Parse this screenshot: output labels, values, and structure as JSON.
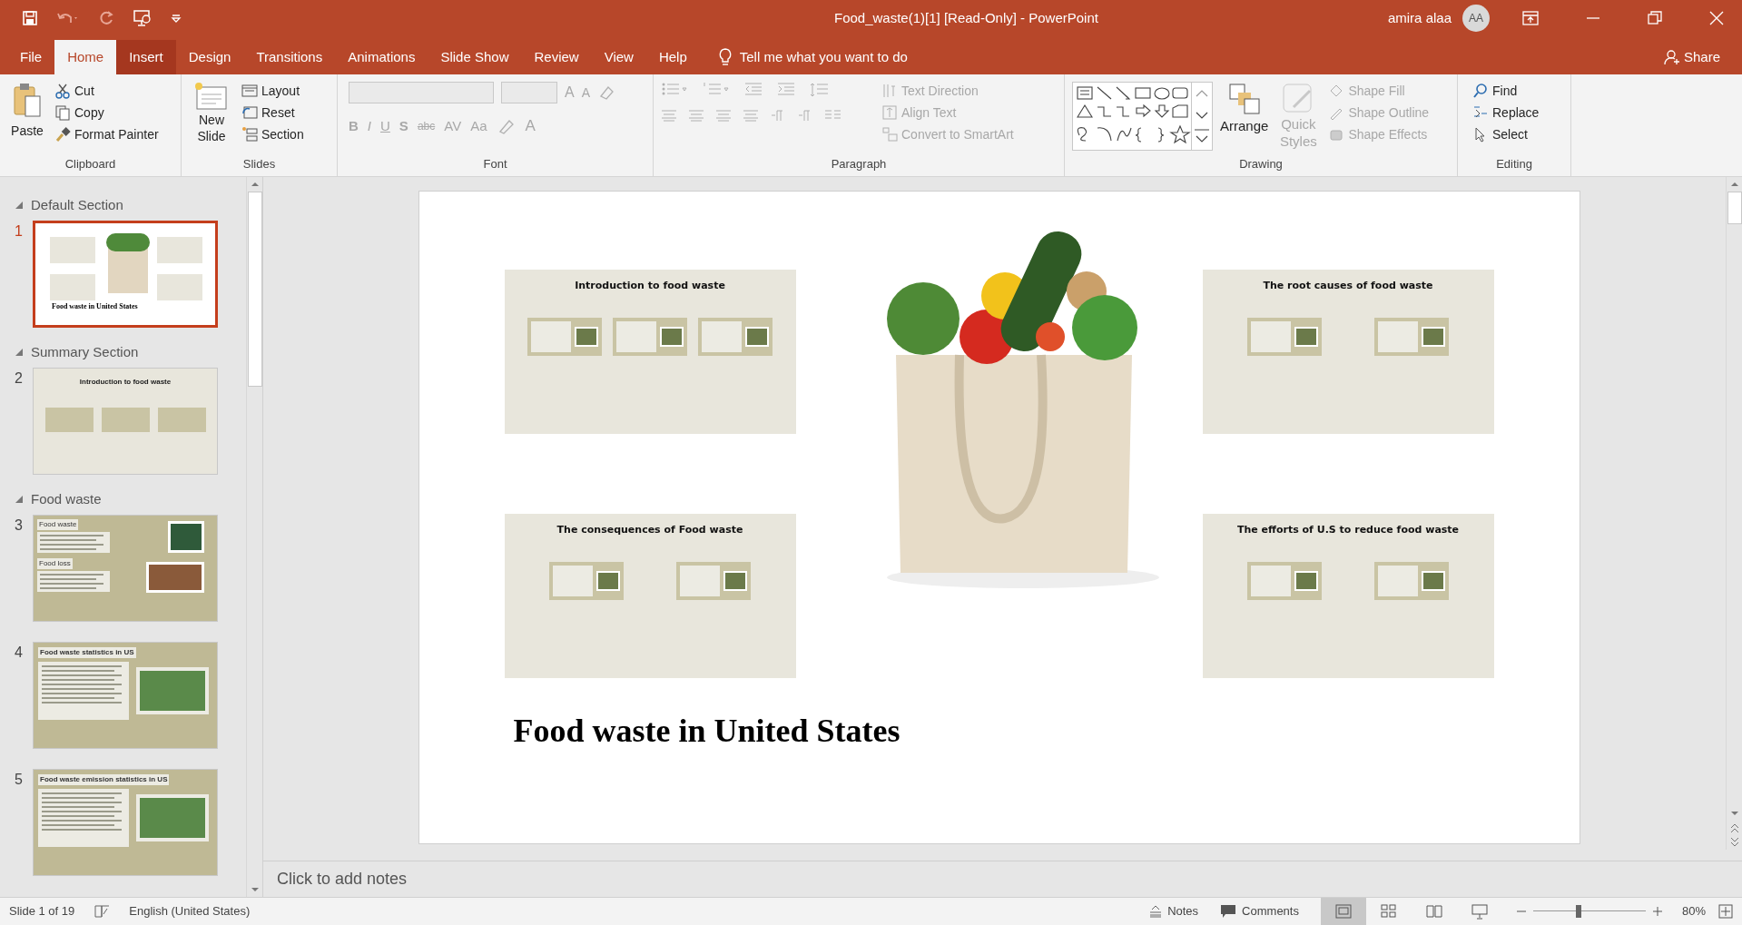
{
  "window": {
    "title": "Food_waste(1)[1] [Read-Only]  -  PowerPoint",
    "user": "amira alaa",
    "avatar": "AA"
  },
  "tabs": [
    {
      "label": "File",
      "selected": false,
      "highlighted": false
    },
    {
      "label": "Home",
      "selected": true,
      "highlighted": false
    },
    {
      "label": "Insert",
      "selected": false,
      "highlighted": true
    },
    {
      "label": "Design",
      "selected": false,
      "highlighted": false
    },
    {
      "label": "Transitions",
      "selected": false,
      "highlighted": false
    },
    {
      "label": "Animations",
      "selected": false,
      "highlighted": false
    },
    {
      "label": "Slide Show",
      "selected": false,
      "highlighted": false
    },
    {
      "label": "Review",
      "selected": false,
      "highlighted": false
    },
    {
      "label": "View",
      "selected": false,
      "highlighted": false
    },
    {
      "label": "Help",
      "selected": false,
      "highlighted": false
    }
  ],
  "tell_me": "Tell me what you want to do",
  "share": "Share",
  "ribbon": {
    "clipboard": {
      "label": "Clipboard",
      "paste": "Paste",
      "items": [
        {
          "label": "Cut",
          "disabled": false
        },
        {
          "label": "Copy",
          "disabled": false
        },
        {
          "label": "Format Painter",
          "disabled": false
        }
      ]
    },
    "slides": {
      "label": "Slides",
      "new_slide": "New Slide",
      "items": [
        {
          "label": "Layout",
          "disabled": false
        },
        {
          "label": "Reset",
          "disabled": false
        },
        {
          "label": "Section",
          "disabled": false
        }
      ]
    },
    "font": {
      "label": "Font",
      "buttons": [
        {
          "label": "B",
          "disabled": true
        },
        {
          "label": "I",
          "disabled": true
        },
        {
          "label": "U",
          "disabled": true
        },
        {
          "label": "S",
          "disabled": true
        },
        {
          "label": "abc",
          "disabled": true
        },
        {
          "label": "AV",
          "disabled": true
        },
        {
          "label": "Aa",
          "disabled": true
        }
      ],
      "color_button": {
        "label": "A",
        "disabled": true
      },
      "grow": {
        "label": "A",
        "disabled": true
      },
      "shrink": {
        "label": "A",
        "disabled": true
      }
    },
    "paragraph": {
      "label": "Paragraph",
      "items": [
        {
          "label": "Text Direction",
          "disabled": true
        },
        {
          "label": "Align Text",
          "disabled": true
        },
        {
          "label": "Convert to SmartArt",
          "disabled": true
        }
      ]
    },
    "drawing": {
      "label": "Drawing",
      "arrange": "Arrange",
      "quick_styles": {
        "label": "Quick Styles",
        "disabled": true
      },
      "items": [
        {
          "label": "Shape Fill",
          "disabled": true
        },
        {
          "label": "Shape Outline",
          "disabled": true
        },
        {
          "label": "Shape Effects",
          "disabled": true
        }
      ]
    },
    "editing": {
      "label": "Editing",
      "items": [
        {
          "label": "Find",
          "disabled": false
        },
        {
          "label": "Replace",
          "disabled": false
        },
        {
          "label": "Select",
          "disabled": false
        }
      ]
    }
  },
  "sections": [
    {
      "name": "Default Section",
      "expanded": true,
      "slides": [
        {
          "number": "1",
          "selected": true,
          "kind": "title",
          "heading": "Food waste in United States"
        }
      ]
    },
    {
      "name": "Summary Section",
      "expanded": true,
      "slides": [
        {
          "number": "2",
          "selected": false,
          "kind": "overview",
          "heading": "Introduction to food waste"
        }
      ]
    },
    {
      "name": "Food waste",
      "expanded": true,
      "slides": [
        {
          "number": "3",
          "selected": false,
          "kind": "definitions",
          "blocks": [
            {
              "heading": "Food waste"
            },
            {
              "heading": "Food loss"
            }
          ]
        },
        {
          "number": "4",
          "selected": false,
          "kind": "bullets",
          "heading": "Food waste statistics in US"
        },
        {
          "number": "5",
          "selected": false,
          "kind": "bullets",
          "heading": "Food waste emission statistics in US"
        }
      ]
    }
  ],
  "slide": {
    "title": "Food waste in United States",
    "cards": [
      {
        "title": "Introduction to food waste"
      },
      {
        "title": "The root causes of food waste"
      },
      {
        "title": "The consequences of Food waste"
      },
      {
        "title": "The efforts of U.S to reduce food waste"
      }
    ]
  },
  "notes": {
    "placeholder": "Click to add notes"
  },
  "status_bar": {
    "slide_info": "Slide 1 of 19",
    "language": "English (United States)",
    "notes": "Notes",
    "comments": "Comments",
    "views": [
      {
        "kind": "normal",
        "selected": true
      },
      {
        "kind": "sorter",
        "selected": false
      },
      {
        "kind": "reading",
        "selected": false
      },
      {
        "kind": "slideshow",
        "selected": false
      }
    ],
    "zoom": {
      "level": 0.4,
      "reading": "80%"
    }
  }
}
